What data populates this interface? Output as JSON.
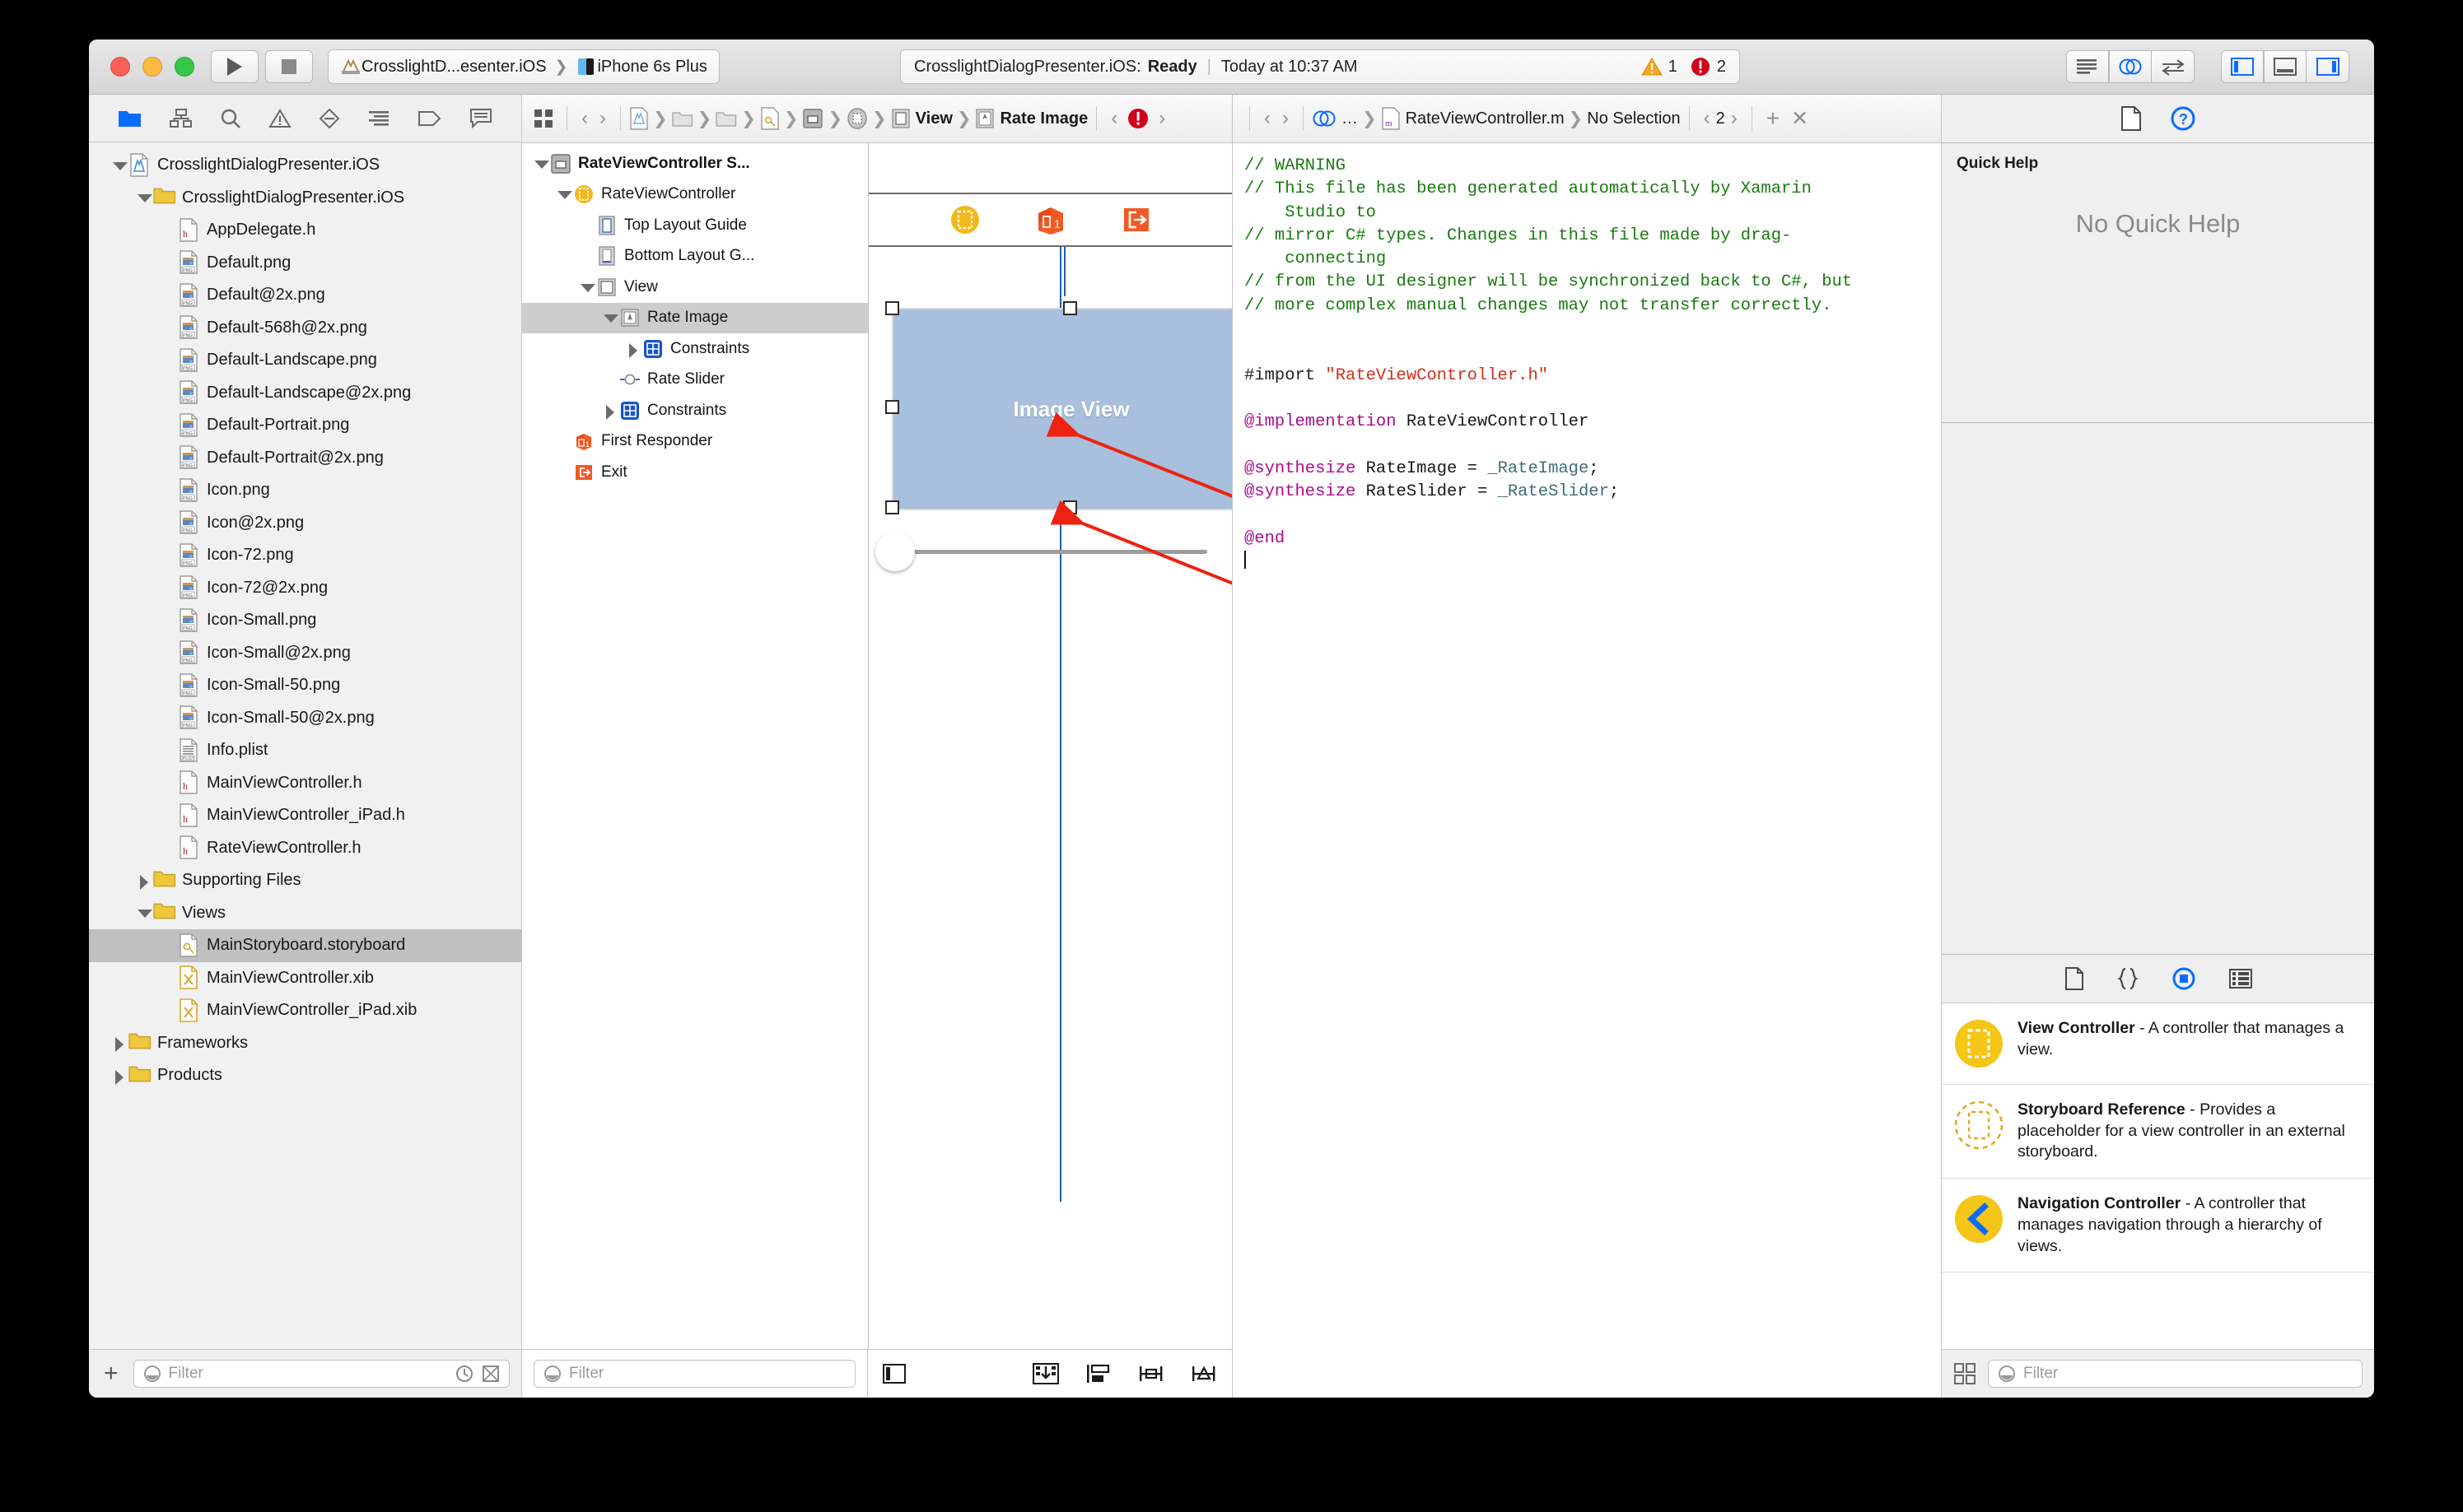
{
  "window": {
    "traffic_lights": [
      "close",
      "minimize",
      "zoom"
    ]
  },
  "toolbar": {
    "run_label": "Run",
    "stop_label": "Stop",
    "scheme_project": "CrosslightD...esenter.iOS",
    "scheme_device": "iPhone 6s Plus",
    "status_project": "CrosslightDialogPresenter.iOS:",
    "status_state": "Ready",
    "status_divider": "|",
    "status_time": "Today at 10:37 AM",
    "warning_count": "1",
    "error_count": "2",
    "view_buttons": [
      "standard-editor",
      "assistant-editor",
      "version-editor"
    ],
    "panel_buttons": [
      "toggle-navigator",
      "toggle-debug-area",
      "toggle-utilities"
    ]
  },
  "navigator": {
    "tabs": [
      {
        "name": "project-navigator",
        "icon": "folder-icon",
        "active": true
      },
      {
        "name": "symbol-navigator",
        "icon": "symbol-icon",
        "active": false
      },
      {
        "name": "find-navigator",
        "icon": "search-icon",
        "active": false
      },
      {
        "name": "issue-navigator",
        "icon": "warning-triangle-icon",
        "active": false
      },
      {
        "name": "test-navigator",
        "icon": "diamond-icon",
        "active": false
      },
      {
        "name": "debug-navigator",
        "icon": "debug-lines-icon",
        "active": false
      },
      {
        "name": "breakpoint-navigator",
        "icon": "tag-icon",
        "active": false
      },
      {
        "name": "report-navigator",
        "icon": "speech-bubble-icon",
        "active": false
      }
    ],
    "tree": [
      {
        "label": "CrosslightDialogPresenter.iOS",
        "indent": 0,
        "icon": "xcodeproj",
        "twisty": "open"
      },
      {
        "label": "CrosslightDialogPresenter.iOS",
        "indent": 1,
        "icon": "folder",
        "twisty": "open"
      },
      {
        "label": "AppDelegate.h",
        "indent": 2,
        "icon": "h",
        "twisty": "none"
      },
      {
        "label": "Default.png",
        "indent": 2,
        "icon": "png",
        "twisty": "none"
      },
      {
        "label": "Default@2x.png",
        "indent": 2,
        "icon": "png",
        "twisty": "none"
      },
      {
        "label": "Default-568h@2x.png",
        "indent": 2,
        "icon": "png",
        "twisty": "none"
      },
      {
        "label": "Default-Landscape.png",
        "indent": 2,
        "icon": "png",
        "twisty": "none"
      },
      {
        "label": "Default-Landscape@2x.png",
        "indent": 2,
        "icon": "png",
        "twisty": "none"
      },
      {
        "label": "Default-Portrait.png",
        "indent": 2,
        "icon": "png",
        "twisty": "none"
      },
      {
        "label": "Default-Portrait@2x.png",
        "indent": 2,
        "icon": "png",
        "twisty": "none"
      },
      {
        "label": "Icon.png",
        "indent": 2,
        "icon": "png",
        "twisty": "none"
      },
      {
        "label": "Icon@2x.png",
        "indent": 2,
        "icon": "png",
        "twisty": "none"
      },
      {
        "label": "Icon-72.png",
        "indent": 2,
        "icon": "png",
        "twisty": "none"
      },
      {
        "label": "Icon-72@2x.png",
        "indent": 2,
        "icon": "png",
        "twisty": "none"
      },
      {
        "label": "Icon-Small.png",
        "indent": 2,
        "icon": "png",
        "twisty": "none"
      },
      {
        "label": "Icon-Small@2x.png",
        "indent": 2,
        "icon": "png",
        "twisty": "none"
      },
      {
        "label": "Icon-Small-50.png",
        "indent": 2,
        "icon": "png",
        "twisty": "none"
      },
      {
        "label": "Icon-Small-50@2x.png",
        "indent": 2,
        "icon": "png",
        "twisty": "none"
      },
      {
        "label": "Info.plist",
        "indent": 2,
        "icon": "plist",
        "twisty": "none"
      },
      {
        "label": "MainViewController.h",
        "indent": 2,
        "icon": "h",
        "twisty": "none"
      },
      {
        "label": "MainViewController_iPad.h",
        "indent": 2,
        "icon": "h",
        "twisty": "none"
      },
      {
        "label": "RateViewController.h",
        "indent": 2,
        "icon": "h",
        "twisty": "none"
      },
      {
        "label": "Supporting Files",
        "indent": 1,
        "icon": "folder",
        "twisty": "closed"
      },
      {
        "label": "Views",
        "indent": 1,
        "icon": "folder",
        "twisty": "open"
      },
      {
        "label": "MainStoryboard.storyboard",
        "indent": 2,
        "icon": "storyboard",
        "twisty": "none",
        "selected": true
      },
      {
        "label": "MainViewController.xib",
        "indent": 2,
        "icon": "xib",
        "twisty": "none"
      },
      {
        "label": "MainViewController_iPad.xib",
        "indent": 2,
        "icon": "xib",
        "twisty": "none"
      },
      {
        "label": "Frameworks",
        "indent": 0,
        "icon": "folder",
        "twisty": "closed"
      },
      {
        "label": "Products",
        "indent": 0,
        "icon": "folder",
        "twisty": "closed"
      }
    ],
    "bottom": {
      "add_label": "+",
      "filter_placeholder": "Filter",
      "recent_icon": "clock-icon",
      "source_control_icon": "source-control-icon"
    }
  },
  "storyboard_editor": {
    "jumpbar": {
      "related_items_icon": "related-items-icon",
      "back_arrow": "‹",
      "forward_arrow": "›",
      "path": [
        {
          "label": "",
          "icon": "xcodeproj"
        },
        {
          "label": "",
          "icon": "folder"
        },
        {
          "label": "",
          "icon": "folder"
        },
        {
          "label": "",
          "icon": "storyboard"
        },
        {
          "label": "",
          "icon": "scene"
        },
        {
          "label": "",
          "icon": "viewcontroller"
        },
        {
          "label": "View",
          "icon": "view"
        },
        {
          "label": "Rate Image",
          "icon": "imageview"
        }
      ],
      "issue_prev": "‹",
      "issue_badge": "error-badge-icon",
      "issue_next": "›"
    },
    "outline": {
      "items": [
        {
          "label": "RateViewController S...",
          "indent": 0,
          "icon": "scene",
          "twisty": "open",
          "bold": true
        },
        {
          "label": "RateViewController",
          "indent": 1,
          "icon": "viewcontroller",
          "twisty": "open"
        },
        {
          "label": "Top Layout Guide",
          "indent": 2,
          "icon": "top-layout-guide",
          "twisty": "none"
        },
        {
          "label": "Bottom Layout G...",
          "indent": 2,
          "icon": "bottom-layout-guide",
          "twisty": "none"
        },
        {
          "label": "View",
          "indent": 2,
          "icon": "view",
          "twisty": "open"
        },
        {
          "label": "Rate Image",
          "indent": 3,
          "icon": "imageview",
          "twisty": "open",
          "selected": true
        },
        {
          "label": "Constraints",
          "indent": 4,
          "icon": "constraints",
          "twisty": "closed"
        },
        {
          "label": "Rate Slider",
          "indent": 3,
          "icon": "slider",
          "twisty": "none"
        },
        {
          "label": "Constraints",
          "indent": 3,
          "icon": "constraints",
          "twisty": "closed"
        },
        {
          "label": "First Responder",
          "indent": 1,
          "icon": "first-responder",
          "twisty": "none"
        },
        {
          "label": "Exit",
          "indent": 1,
          "icon": "exit",
          "twisty": "none"
        }
      ],
      "filter_placeholder": "Filter"
    },
    "canvas": {
      "imageview_label": "Image View",
      "dock_icons": [
        "viewcontroller-dock-icon",
        "first-responder-dock-icon",
        "exit-dock-icon"
      ]
    },
    "bottom_bar": {
      "outline_toggle_icon": "document-outline-toggle-icon",
      "tools": [
        "auto-layout-resolve-icon",
        "auto-layout-pin-icon",
        "auto-layout-align-icon",
        "auto-layout-resize-icon"
      ]
    }
  },
  "source_editor": {
    "jumpbar": {
      "back_arrow": "‹",
      "forward_arrow": "›",
      "related_icon": "assistant-related-icon",
      "ellipsis": "…",
      "file_icon": "m-file-icon",
      "file_name": "RateViewController.m",
      "selection": "No Selection",
      "counter_prev": "‹",
      "counter": "2",
      "counter_next": "›",
      "add_assistant": "+",
      "close_assistant": "✕"
    },
    "code_lines": [
      {
        "type": "comment",
        "text": "// WARNING"
      },
      {
        "type": "comment",
        "text": "// This file has been generated automatically by Xamarin"
      },
      {
        "type": "comment",
        "text": "    Studio to"
      },
      {
        "type": "comment",
        "text": "// mirror C# types. Changes in this file made by drag-"
      },
      {
        "type": "comment",
        "text": "    connecting"
      },
      {
        "type": "comment",
        "text": "// from the UI designer will be synchronized back to C#, but"
      },
      {
        "type": "comment",
        "text": "// more complex manual changes may not transfer correctly."
      },
      {
        "type": "blank",
        "text": ""
      },
      {
        "type": "blank",
        "text": ""
      },
      {
        "type": "import",
        "pre": "#import ",
        "str": "\"RateViewController.h\""
      },
      {
        "type": "blank",
        "text": ""
      },
      {
        "type": "impl",
        "keyword": "@implementation",
        "plain": " RateViewController"
      },
      {
        "type": "blank",
        "text": ""
      },
      {
        "type": "synth",
        "keyword": "@synthesize",
        "plain": " RateImage = ",
        "ivar": "_RateImage",
        "tail": ";"
      },
      {
        "type": "synth",
        "keyword": "@synthesize",
        "plain": " RateSlider = ",
        "ivar": "_RateSlider",
        "tail": ";"
      },
      {
        "type": "blank",
        "text": ""
      },
      {
        "type": "end",
        "keyword": "@end"
      },
      {
        "type": "caret",
        "text": ""
      }
    ]
  },
  "utilities": {
    "inspector_tabs": [
      {
        "name": "file-inspector",
        "icon": "document-icon",
        "active": false
      },
      {
        "name": "quick-help-inspector",
        "icon": "help-circle-icon",
        "active": true
      }
    ],
    "quick_help": {
      "title": "Quick Help",
      "empty_message": "No Quick Help"
    },
    "library_tabs": [
      {
        "name": "file-template-library",
        "icon": "document-icon",
        "active": false
      },
      {
        "name": "code-snippet-library",
        "icon": "braces-icon",
        "active": false
      },
      {
        "name": "object-library",
        "icon": "circle-square-icon",
        "active": true
      },
      {
        "name": "media-library",
        "icon": "media-icon",
        "active": false
      }
    ],
    "library_items": [
      {
        "icon": "view-controller-icon",
        "title": "View Controller",
        "description": " - A controller that manages a view."
      },
      {
        "icon": "storyboard-reference-icon",
        "title": "Storyboard Reference",
        "description": " - Provides a placeholder for a view controller in an external storyboard."
      },
      {
        "icon": "navigation-controller-icon",
        "title": "Navigation Controller",
        "description": " - A controller that manages navigation through a hierarchy of views."
      }
    ],
    "library_bottom": {
      "layout_icon": "grid-layout-icon",
      "filter_placeholder": "Filter"
    }
  },
  "colors": {
    "accent_blue": "#0a6cff",
    "selection_gray": "#c0c0c0",
    "comment_green": "#1a7a10",
    "string_red": "#d12f1b",
    "keyword_magenta": "#a90d91",
    "ivar_teal": "#3f6e74",
    "imageview_fill": "#a8bfdd",
    "annotation_red": "#ee2211",
    "warning_yellow": "#f5a623",
    "error_red": "#d0021b"
  }
}
